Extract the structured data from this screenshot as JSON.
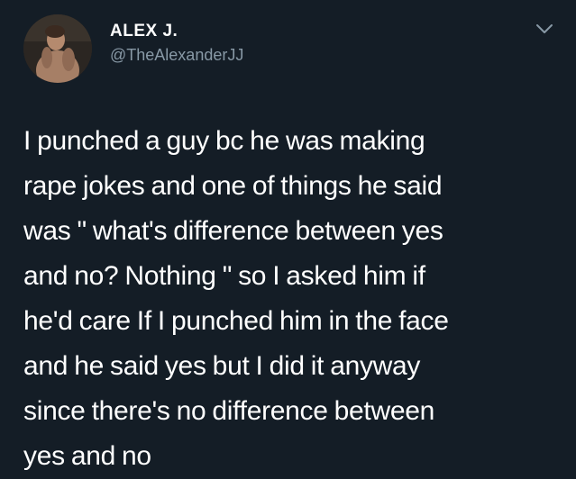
{
  "user": {
    "display_name": "ALEX J.",
    "handle": "@TheAlexanderJJ",
    "avatar_icon": "profile-photo"
  },
  "menu": {
    "icon": "chevron-down-icon"
  },
  "tweet": {
    "lines": [
      "I punched a guy bc he was making",
      "rape jokes and one of things he said",
      "was \" what's difference between yes",
      "and no? Nothing \" so I asked him if",
      "he'd care If I punched him in the face",
      "and he said yes but I did it anyway",
      "since there's no difference between",
      "yes and no"
    ]
  },
  "colors": {
    "background": "#141d26",
    "text": "#ffffff",
    "secondary_text": "#8899a6"
  }
}
